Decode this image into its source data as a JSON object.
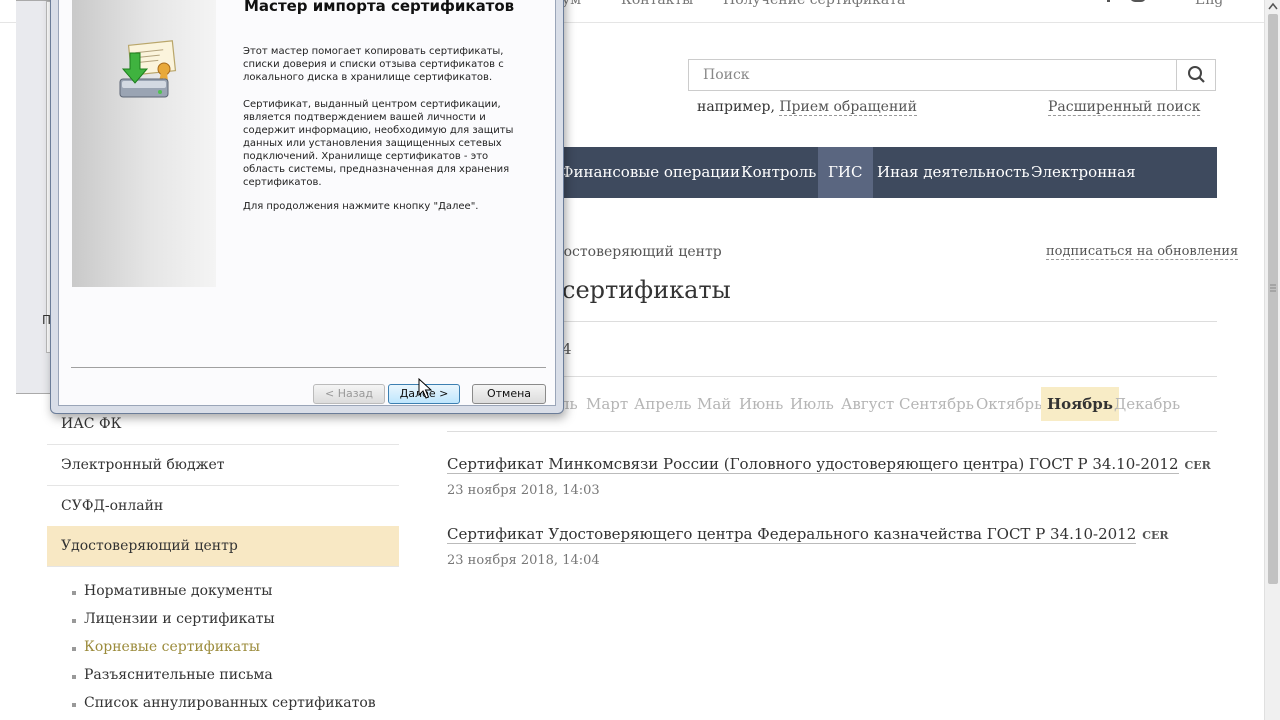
{
  "topnav": {
    "item1": "ум",
    "item2": "Контакты",
    "item3": "Получение сертификата",
    "lang": "Eng"
  },
  "search": {
    "placeholder": "Поиск",
    "example_prefix": "например,",
    "example_link": "Прием обращений",
    "advanced": "Расширенный поиск"
  },
  "mainnav": [
    "Финансовые операции",
    "Контроль",
    "ГИС",
    "Иная деятельность",
    "Электронная приемная"
  ],
  "breadcrumb": "достоверяющий центр",
  "subscribe": "подписаться на обновления",
  "page_title": "сертификаты",
  "year": "4",
  "months": [
    "ль",
    "Март",
    "Апрель",
    "Май",
    "Июнь",
    "Июль",
    "Август",
    "Сентябрь",
    "Октябрь",
    "Ноябрь",
    "Декабрь"
  ],
  "active_month": "Ноябрь",
  "documents": [
    {
      "title": "Сертификат Минкомсвязи России (Головного удостоверяющего центра) ГОСТ Р 34.10-2012",
      "format": "CER",
      "date": "23 ноября 2018, 14:03"
    },
    {
      "title": "Сертификат Удостоверяющего центра Федерального казначейства ГОСТ Р 34.10-2012",
      "format": "CER",
      "date": "23 ноября 2018, 14:04"
    }
  ],
  "sidebar": [
    "ИАС ФК",
    "Электронный бюджет",
    "СУФД-онлайн",
    "Удостоверяющий центр"
  ],
  "subitems": [
    "Нормативные документы",
    "Лицензии и сертификаты",
    "Корневые сертификаты",
    "Разъяснительные письма",
    "Список аннулированных сертификатов"
  ],
  "bg_window_letter": "П",
  "dialog": {
    "title": "Мастер импорта сертификатов",
    "para1": "Этот мастер помогает копировать сертификаты, списки доверия и списки отзыва сертификатов с локального диска в хранилище сертификатов.",
    "para2": "Сертификат, выданный центром сертификации, является подтверждением вашей личности и содержит информацию, необходимую для защиты данных или установления защищенных сетевых подключений. Хранилище сертификатов - это область системы, предназначенная для хранения сертификатов.",
    "para3": "Для продолжения нажмите кнопку \"Далее\".",
    "back": "< Назад",
    "next": "Далее >",
    "cancel": "Отмена"
  }
}
